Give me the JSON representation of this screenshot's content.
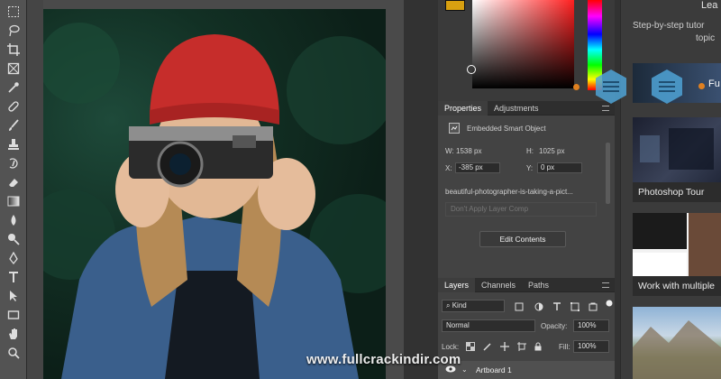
{
  "properties_panel": {
    "tabs": [
      "Properties",
      "Adjustments"
    ],
    "object_type": "Embedded Smart Object",
    "width_label": "W:",
    "width_value": "1538 px",
    "height_label": "H:",
    "height_value": "1025 px",
    "x_label": "X:",
    "x_value": "-385 px",
    "y_label": "Y:",
    "y_value": "0 px",
    "filename": "beautiful-photographer-is-taking-a-pict...",
    "layer_comp": "Don't Apply Layer Comp",
    "edit_button": "Edit Contents"
  },
  "layers_panel": {
    "tabs": [
      "Layers",
      "Channels",
      "Paths"
    ],
    "filter_kind": "Kind",
    "blend_mode": "Normal",
    "opacity_label": "Opacity:",
    "opacity_value": "100%",
    "lock_label": "Lock:",
    "fill_label": "Fill:",
    "fill_value": "100%",
    "layer_name": "Artboard 1"
  },
  "learn_panel": {
    "title": "Lea",
    "subtitle_line1": "Step-by-step tutor",
    "subtitle_line2": "topic",
    "partial_label": "Fu",
    "tutorials": [
      "Photoshop Tour",
      "Work with multiple"
    ]
  },
  "watermark": "www.fullcrackindir.com",
  "colors": {
    "foreground_swatch": "#d8a010",
    "hue_marker": "#e08020",
    "hex_icon": "#4fa3d6"
  },
  "icons": [
    "marquee-icon",
    "lasso-icon",
    "crop-icon",
    "frame-icon",
    "eyedropper-icon",
    "healing-icon",
    "brush-icon",
    "stamp-icon",
    "history-brush-icon",
    "eraser-icon",
    "gradient-icon",
    "blur-icon",
    "dodge-icon",
    "pen-icon",
    "type-icon",
    "path-select-icon",
    "rectangle-icon"
  ]
}
